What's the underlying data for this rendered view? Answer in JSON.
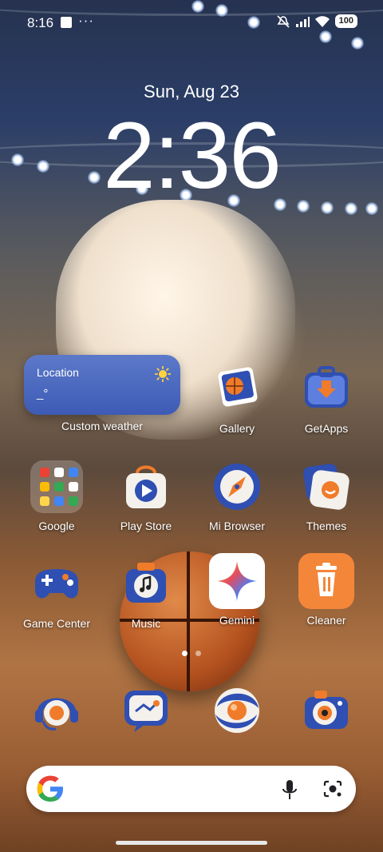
{
  "status_bar": {
    "time": "8:16",
    "battery": "100",
    "icons": [
      "screenshot-icon",
      "more-icon",
      "mute-icon",
      "signal-icon",
      "wifi-icon",
      "battery-icon"
    ]
  },
  "lock": {
    "date": "Sun, Aug 23",
    "clock": "2:36"
  },
  "weather_widget": {
    "location": "Location",
    "temperature": "_°",
    "label": "Custom weather",
    "icon": "sun-icon"
  },
  "apps": {
    "gallery": "Gallery",
    "getapps": "GetApps",
    "google": "Google",
    "playstore": "Play Store",
    "mibrowser": "Mi Browser",
    "themes": "Themes",
    "gamecenter": "Game Center",
    "music": "Music",
    "gemini": "Gemini",
    "cleaner": "Cleaner"
  },
  "dock": [
    "headset-service-icon",
    "chat-icon",
    "browser-orb-icon",
    "camera-icon"
  ],
  "page_indicator": {
    "count": 2,
    "active": 1
  },
  "colors": {
    "accent_blue": "#2f4fb2",
    "accent_orange": "#f07b2a",
    "cleaner_orange": "#f4863a"
  }
}
